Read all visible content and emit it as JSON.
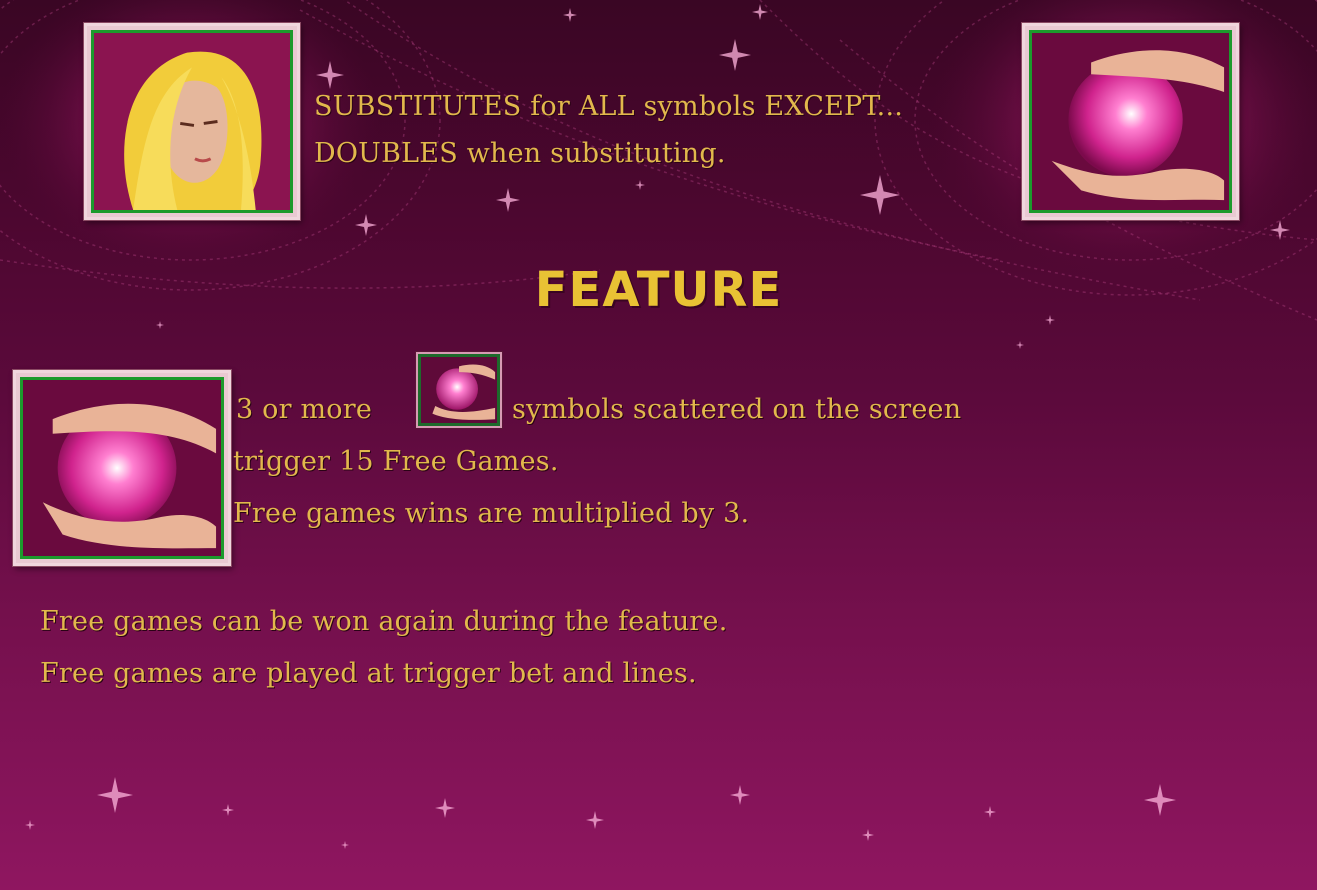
{
  "paytable": {
    "wild_line1": "SUBSTITUTES for ALL symbols EXCEPT...",
    "wild_line2": "DOUBLES when substituting.",
    "feature_title": "FEATURE",
    "scatter_pre": "3 or more",
    "scatter_post": "symbols scattered on the screen",
    "trigger_line": "trigger 15 Free Games.",
    "multiplier_line": "Free games wins are multiplied by 3.",
    "retrigger_line": "Free games can be won again during the feature.",
    "bet_line": "Free games are played at trigger bet and lines."
  },
  "symbols": {
    "wild": "blonde-sorceress-icon",
    "scatter": "crystal-ball-hands-icon"
  },
  "colors": {
    "text": "#e2b84c",
    "title": "#e9c234",
    "background": "#5c0a3c",
    "tile_border": "#1c9a2c"
  }
}
